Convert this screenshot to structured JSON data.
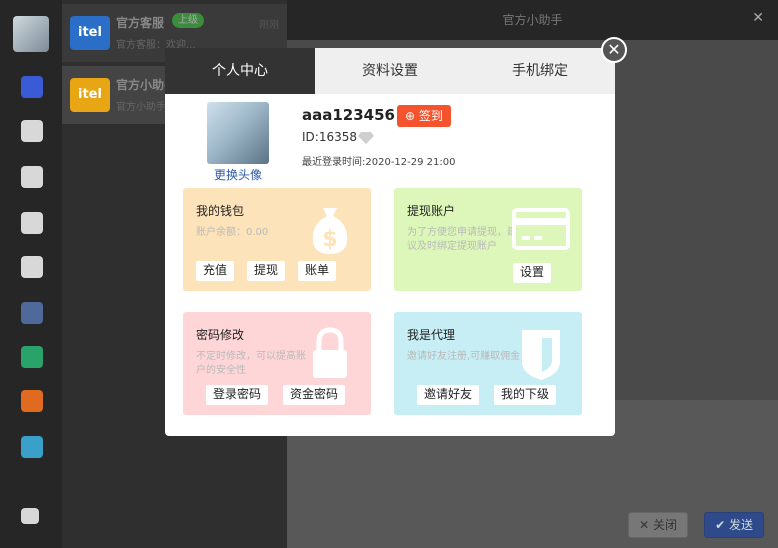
{
  "sidebar": {
    "icons": [
      "avatar",
      "cloud-icon",
      "contacts-icon",
      "group-icon",
      "user-icon",
      "speaker-icon",
      "baidu-icon",
      "app-icon",
      "taobao-icon",
      "list-icon",
      "logout-icon"
    ]
  },
  "conversations": [
    {
      "logo": "itel",
      "name": "官方客服",
      "badge": "上级",
      "time": "刚刚",
      "preview": "官方客服：欢迎..."
    },
    {
      "logo": "itel",
      "name": "官方小助手",
      "preview": "官方小助手..."
    }
  ],
  "chat": {
    "title": "官方小助手",
    "close_label": "关闭",
    "send_label": "发送"
  },
  "modal": {
    "tabs": [
      "个人中心",
      "资料设置",
      "手机绑定"
    ],
    "active_tab": "个人中心",
    "profile": {
      "username": "aaa123456",
      "checkin_label": "签到",
      "id": "ID:16358",
      "last_login": "最近登录时间:2020-12-29 21:00",
      "change_avatar": "更换头像"
    },
    "cards": {
      "wallet": {
        "title": "我的钱包",
        "desc": "账户余额：0.00",
        "buttons": [
          "充值",
          "提现",
          "账单"
        ]
      },
      "withdraw": {
        "title": "提现账户",
        "desc": "为了方便您申请提现，建议及时绑定提现账户",
        "buttons": [
          "设置"
        ]
      },
      "password": {
        "title": "密码修改",
        "desc": "不定时修改，可以提高账户的安全性",
        "buttons": [
          "登录密码",
          "资金密码"
        ]
      },
      "agent": {
        "title": "我是代理",
        "desc": "邀请好友注册,可赚取佣金",
        "buttons": [
          "邀请好友",
          "我的下级"
        ]
      }
    }
  },
  "colors": {
    "wallet_bg": "#fde3b9",
    "withdraw_bg": "#dcf7b9",
    "password_bg": "#ffd6d8",
    "agent_bg": "#c6eef4",
    "checkin_bg": "#f5532d",
    "active_tab_bg": "#333333"
  }
}
